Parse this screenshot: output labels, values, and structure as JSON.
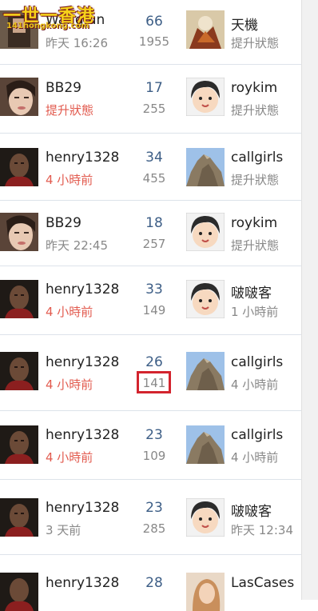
{
  "watermark": {
    "chinese": "一世一香港",
    "url": "141hongkong.com"
  },
  "rows": [
    {
      "left_name": "WangJun",
      "left_time": "昨天 16:26",
      "left_time_hot": false,
      "count_top": "66",
      "count_bottom": "1955",
      "right_name": "天機",
      "right_time": "提升狀態",
      "left_avatar": "avatar-photo",
      "right_avatar": "artwork-avatar"
    },
    {
      "left_name": "BB29",
      "left_time": "提升狀態",
      "left_time_hot": true,
      "count_top": "17",
      "count_bottom": "255",
      "right_name": "roykim",
      "right_time": "提升狀態",
      "left_avatar": "woman-avatar",
      "right_avatar": "cartoon-avatar"
    },
    {
      "left_name": "henry1328",
      "left_time": "4 小時前",
      "left_time_hot": true,
      "count_top": "34",
      "count_bottom": "455",
      "right_name": "callgirls",
      "right_time": "提升狀態",
      "left_avatar": "man-avatar",
      "right_avatar": "rock-avatar"
    },
    {
      "left_name": "BB29",
      "left_time": "昨天 22:45",
      "left_time_hot": false,
      "count_top": "18",
      "count_bottom": "257",
      "right_name": "roykim",
      "right_time": "提升狀態",
      "left_avatar": "woman-avatar",
      "right_avatar": "cartoon-avatar"
    },
    {
      "left_name": "henry1328",
      "left_time": "4 小時前",
      "left_time_hot": true,
      "count_top": "33",
      "count_bottom": "149",
      "right_name": "啵啵客",
      "right_time": "1 小時前",
      "left_avatar": "man-avatar",
      "right_avatar": "cartoon-avatar"
    },
    {
      "left_name": "henry1328",
      "left_time": "4 小時前",
      "left_time_hot": true,
      "count_top": "26",
      "count_bottom": "141",
      "right_name": "callgirls",
      "right_time": "4 小時前",
      "left_avatar": "man-avatar",
      "right_avatar": "rock-avatar"
    },
    {
      "left_name": "henry1328",
      "left_time": "4 小時前",
      "left_time_hot": true,
      "count_top": "23",
      "count_bottom": "109",
      "right_name": "callgirls",
      "right_time": "4 小時前",
      "left_avatar": "man-avatar",
      "right_avatar": "rock-avatar"
    },
    {
      "left_name": "henry1328",
      "left_time": "3 天前",
      "left_time_hot": false,
      "count_top": "23",
      "count_bottom": "285",
      "right_name": "啵啵客",
      "right_time": "昨天 12:34",
      "left_avatar": "man-avatar",
      "right_avatar": "cartoon-avatar"
    },
    {
      "left_name": "henry1328",
      "left_time": "",
      "left_time_hot": false,
      "count_top": "28",
      "count_bottom": "",
      "right_name": "LasCases",
      "right_time": "",
      "left_avatar": "man-avatar",
      "right_avatar": "woman-photo-avatar"
    }
  ],
  "colors": {
    "hot_time": "#e25b4f",
    "count": "#3d5e86",
    "muted": "#888888",
    "highlight": "#d3242e",
    "divider": "#dde3ea"
  }
}
